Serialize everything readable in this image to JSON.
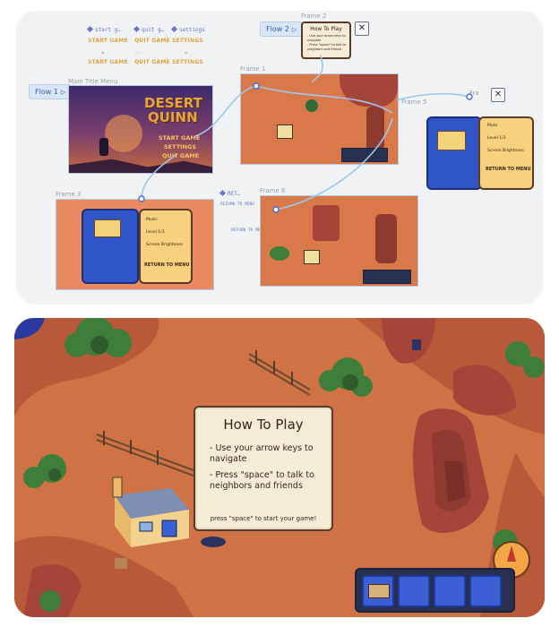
{
  "canvas": {
    "top_labels": [
      {
        "label": "start g…",
        "button": "START GAME"
      },
      {
        "label": "quit g…",
        "button": "QUIT GAME"
      },
      {
        "label": "settings",
        "button": "SETTINGS"
      }
    ],
    "second_row_buttons": [
      "START GAME",
      "QUIT GAME",
      "SETTINGS"
    ],
    "flow1": "Flow 1",
    "flow2": "Flow 2",
    "frame_labels": {
      "main": "Main Title Menu",
      "frame1": "Frame 1",
      "frame2": "Frame 2",
      "frame3": "Frame 3",
      "frame5": "Frame 5",
      "frame6": "Frame 6",
      "fra": "Fra",
      "ret": "RET…"
    },
    "frame2_card": {
      "title": "How To Play",
      "line1": "- Use your arrow keys to navigate",
      "line2": "- Press \"space\" to talk to neighbors and friends"
    },
    "main_menu": {
      "logo1": "DESERT",
      "logo2": "QUINN",
      "buttons": [
        "START GAME",
        "SETTINGS",
        "QUIT GAME"
      ]
    },
    "settings_card": {
      "rows": [
        "Mute",
        "Level 1/3",
        "Screen Brightness"
      ],
      "return": "RETURN TO MENU"
    },
    "frame3_card": {
      "rows": [
        "Music",
        "Level 1/3",
        "Screen Brightness"
      ],
      "return": "RETURN TO MENU"
    },
    "return_links": [
      "RETURN TO MENU",
      "RETURN TO MENU"
    ],
    "accent": "#6b74c9",
    "wire_color": "#9cc7ea"
  },
  "game": {
    "dialog_title": "How To Play",
    "dialog_line1": "- Use your arrow keys to navigate",
    "dialog_line2": "- Press \"space\" to talk to neighbors and friends",
    "dialog_footer": "press \"space\" to start your game!",
    "inventory_slots": 4,
    "colors": {
      "sand": "#cf7346",
      "rock": "#a5453a",
      "grass": "#3f7d3a",
      "slot": "#3c5fd6"
    }
  }
}
